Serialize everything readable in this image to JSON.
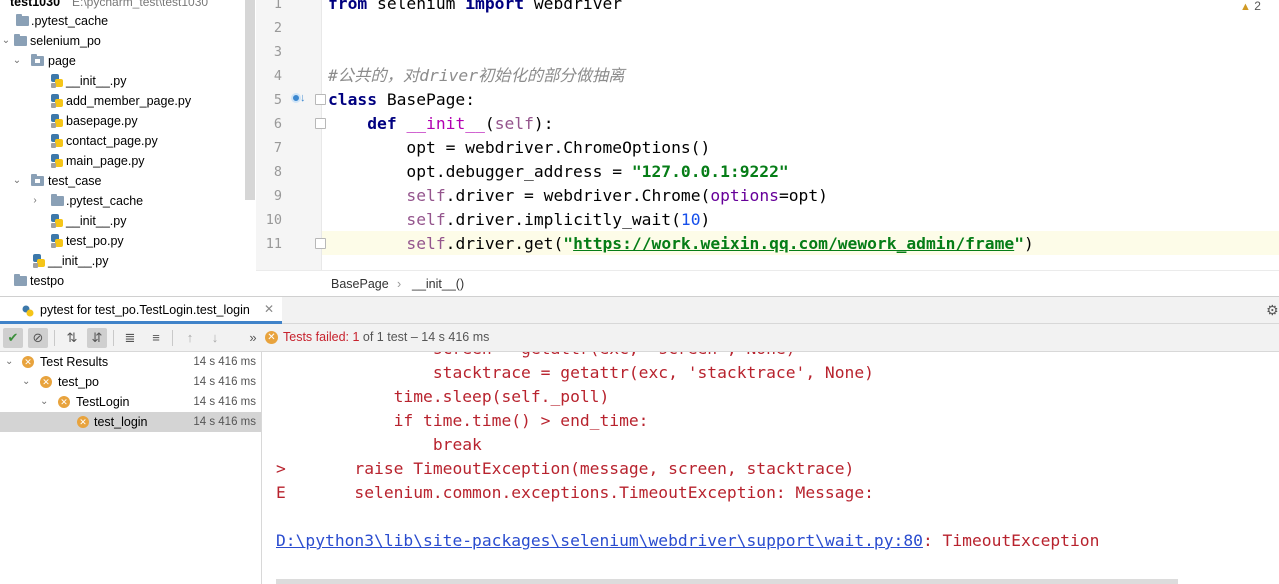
{
  "project": {
    "root": {
      "name": "test1030",
      "path": "E:\\pycharm_test\\test1030"
    },
    "items": [
      {
        "label": ".pytest_cache",
        "kind": "folder"
      },
      {
        "label": "selenium_po",
        "kind": "folder"
      },
      {
        "label": "page",
        "kind": "package"
      },
      {
        "label": "__init__.py",
        "kind": "py"
      },
      {
        "label": "add_member_page.py",
        "kind": "py"
      },
      {
        "label": "basepage.py",
        "kind": "py"
      },
      {
        "label": "contact_page.py",
        "kind": "py"
      },
      {
        "label": "main_page.py",
        "kind": "py"
      },
      {
        "label": "test_case",
        "kind": "package"
      },
      {
        "label": ".pytest_cache",
        "kind": "folder"
      },
      {
        "label": "__init__.py",
        "kind": "py"
      },
      {
        "label": "test_po.py",
        "kind": "py"
      },
      {
        "label": "__init__.py",
        "kind": "py"
      },
      {
        "label": "testpo",
        "kind": "folder"
      }
    ]
  },
  "editor": {
    "line_numbers": [
      "1",
      "2",
      "3",
      "4",
      "5",
      "6",
      "7",
      "8",
      "9",
      "10",
      "11"
    ],
    "warning_count": "2",
    "code": {
      "l1_kw1": "from",
      "l1_mod": " selenium ",
      "l1_kw2": "import",
      "l1_rest": " webdriver",
      "l4_comment": "#公共的，对driver初始化的部分做抽离",
      "l5_kw": "class",
      "l5_rest": " BasePage:",
      "l6_kw": "def",
      "l6_magic": "__init__",
      "l6_paren1": "(",
      "l6_self": "self",
      "l6_paren2": "):",
      "l7": "opt = webdriver.ChromeOptions()",
      "l8_a": "opt.debugger_address = ",
      "l8_str": "\"127.0.0.1:9222\"",
      "l9_self": "self",
      "l9_a": ".driver = webdriver.Chrome(",
      "l9_param": "options",
      "l9_b": "=opt)",
      "l10_self": "self",
      "l10_a": ".driver.implicitly_wait(",
      "l10_num": "10",
      "l10_b": ")",
      "l11_self": "self",
      "l11_a": ".driver.get(",
      "l11_q1": "\"",
      "l11_url": "https://work.weixin.qq.com/wework_admin/frame",
      "l11_q2": "\"",
      "l11_b": ")"
    },
    "breadcrumb": [
      "BasePage",
      "__init__()"
    ]
  },
  "run": {
    "tab_label": "pytest for test_po.TestLogin.test_login",
    "status": {
      "failed": "Tests failed: ",
      "count": "1",
      "rest": " of 1 test – 14 s 416 ms"
    },
    "results": [
      {
        "label": "Test Results",
        "time": "14 s 416 ms"
      },
      {
        "label": "test_po",
        "time": "14 s 416 ms"
      },
      {
        "label": "TestLogin",
        "time": "14 s 416 ms"
      },
      {
        "label": "test_login",
        "time": "14 s 416 ms"
      }
    ],
    "console": {
      "l0": "                screen = getattr(exc, 'screen', None)",
      "l1": "                stacktrace = getattr(exc, 'stacktrace', None)",
      "l2": "            time.sleep(self._poll)",
      "l3": "            if time.time() > end_time:",
      "l4": "                break",
      "l5": ">       raise TimeoutException(message, screen, stacktrace)",
      "l6": "E       selenium.common.exceptions.TimeoutException: Message:",
      "l8_link": "D:\\python3\\lib\\site-packages\\selenium\\webdriver\\support\\wait.py:80",
      "l8_rest": ": TimeoutException"
    }
  },
  "colors": {
    "accent": "#4083c9",
    "failed": "#c7222d",
    "warning": "#e8a33d"
  }
}
